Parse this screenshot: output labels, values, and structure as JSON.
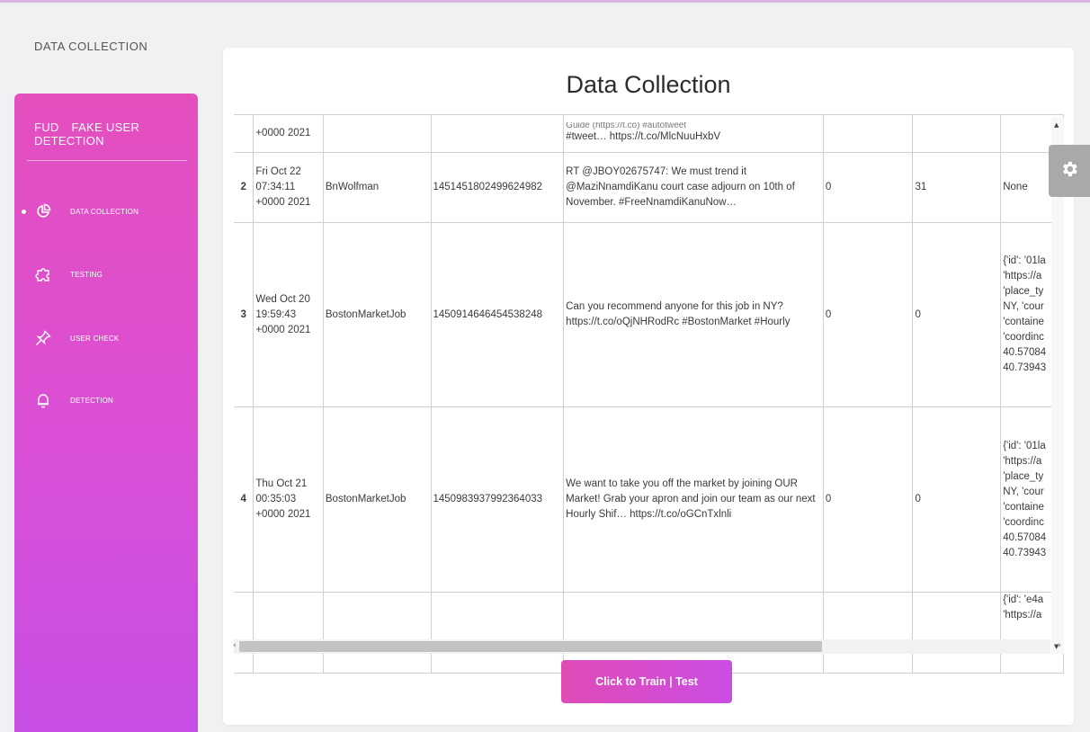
{
  "page_label": "DATA COLLECTION",
  "sidebar": {
    "brand_abbr": "FUD",
    "brand_name": "FAKE USER DETECTION",
    "items": [
      {
        "label": "DATA COLLECTION",
        "icon": "pie-chart-icon",
        "active": true
      },
      {
        "label": "TESTING",
        "icon": "puzzle-icon",
        "active": false
      },
      {
        "label": "USER CHECK",
        "icon": "pin-icon",
        "active": false
      },
      {
        "label": "DETECTION",
        "icon": "bell-icon",
        "active": false
      }
    ]
  },
  "main": {
    "title": "Data Collection",
    "rows": [
      {
        "index": "",
        "date": "+0000 2021",
        "user": "",
        "id": "",
        "text_cut": "Guide (https://t.co) #autotweet",
        "text": "#tweet… https://t.co/MlcNuuHxbV",
        "col5": "",
        "col6": "",
        "place": ""
      },
      {
        "index": "2",
        "date": "Fri Oct 22 07:34:11 +0000 2021",
        "user": "BnWolfman",
        "id": "1451451802499624982",
        "text_cut": "",
        "text": "RT @JBOY02675747: We must trend it @MaziNnamdiKanu court case adjourn on 10th of November. #FreeNnamdiKanuNow…",
        "col5": "0",
        "col6": "31",
        "place": "None"
      },
      {
        "index": "3",
        "date": "Wed Oct 20 19:59:43 +0000 2021",
        "user": "BostonMarketJob",
        "id": "1450914646454538248",
        "text_cut": "",
        "text": "Can you recommend anyone for this job in NY? https://t.co/oQjNHRodRc #BostonMarket #Hourly",
        "col5": "0",
        "col6": "0",
        "place_lines": [
          "{'id': '01la",
          "'https://a",
          "'place_ty",
          "NY, 'cour",
          "'containe",
          "'coordinc",
          "40.57084",
          "40.73943"
        ]
      },
      {
        "index": "4",
        "date": "Thu Oct 21 00:35:03 +0000 2021",
        "user": "BostonMarketJob",
        "id": "1450983937992364033",
        "text_cut": "",
        "text": "We want to take you off the market by joining OUR Market! Grab your apron and join our team as our next Hourly Shif… https://t.co/oGCnTxlnli",
        "col5": "0",
        "col6": "0",
        "place_lines": [
          "{'id': '01la",
          "'https://a",
          "'place_ty",
          "NY, 'cour",
          "'containe",
          "'coordinc",
          "40.57084",
          "40.73943"
        ]
      },
      {
        "index": "",
        "date": "",
        "user": "",
        "id": "",
        "text_cut": "",
        "text": "",
        "col5": "",
        "col6": "",
        "place_lines": [
          "{'id': 'e4a",
          "'https://a"
        ]
      }
    ],
    "button_label": "Click to Train | Test"
  },
  "colors": {
    "sidebar_top": "#e44fbe",
    "sidebar_bottom": "#c64ee4",
    "button": "#d64cc8"
  }
}
